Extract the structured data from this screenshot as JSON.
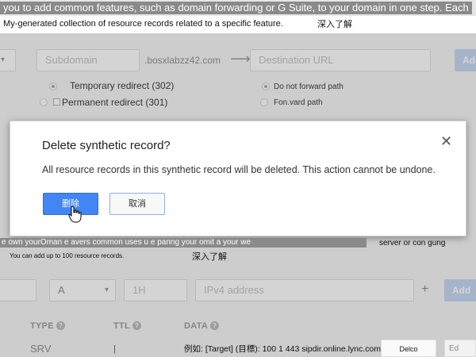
{
  "top_banner": {
    "text": "you to add common features, such as domain forwarding or G Suite, to your domain in one step. Each synth",
    "subtext": "My-generated collection of resource records related to a specific feature.",
    "learn_more": "深入了解"
  },
  "forwarding_form": {
    "subdomain_placeholder": "Subdomain",
    "domain_suffix": ".bosxlabzz42.com",
    "arrow": "⟶",
    "destination_placeholder": "Destination URL",
    "add_button": "Add",
    "redirect_options": [
      {
        "label": "Temporary redirect (302)",
        "selected": true
      },
      {
        "label": "Permanent redirect (301)",
        "selected": false
      }
    ],
    "path_options": [
      {
        "label": "Do not forward path",
        "selected": true
      },
      {
        "label": "Fon.vard path",
        "selected": false
      }
    ]
  },
  "dialog": {
    "title": "Delete synthetic record?",
    "body": "All resource records in this synthetic record will be deleted. This action cannot be undone.",
    "delete_button": "删除",
    "cancel_button": "取消",
    "close_icon": "close-icon"
  },
  "lower_banner": {
    "text": "e own yourOman e avers common uses u e panng your omit a your we",
    "right_text": "server or con gung",
    "subtext": "You can add up to 100 resource records.",
    "learn_more": "深入了解"
  },
  "record_form": {
    "record_type": "A",
    "ttl_placeholder": "1H",
    "data_placeholder": "IPv4 address",
    "plus": "+",
    "add_button": "Add"
  },
  "table": {
    "headers": [
      "TYPE",
      "TTL",
      "DATA"
    ],
    "help_icon": "?",
    "rows": [
      {
        "type": "SRV",
        "ttl": "|",
        "data": "例如: [Target] (目標): 100 1 443 sipdir.online.lync.com.",
        "action1": "Delco",
        "action2": "Ed"
      }
    ]
  },
  "colors": {
    "primary": "#4285f4",
    "overlay": "#787878",
    "banner": "#8a8a8a"
  }
}
